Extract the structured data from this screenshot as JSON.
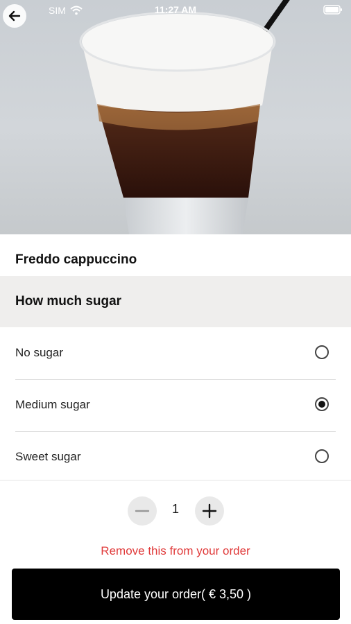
{
  "status_bar": {
    "carrier": "SIM",
    "time": "11:27 AM"
  },
  "product": {
    "name": "Freddo cappuccino"
  },
  "sugar_section": {
    "title": "How much sugar",
    "options": [
      {
        "label": "No sugar",
        "selected": false
      },
      {
        "label": "Medium sugar",
        "selected": true
      },
      {
        "label": "Sweet sugar",
        "selected": false
      }
    ]
  },
  "quantity": {
    "value": "1"
  },
  "actions": {
    "remove_label": "Remove this from your order",
    "update_label": "Update your order( € 3,50 )"
  },
  "colors": {
    "accent_red": "#e03a3a",
    "cta_bg": "#000000",
    "section_bg": "#efeeed"
  },
  "icons": [
    "back-arrow-icon",
    "wifi-icon",
    "battery-icon",
    "minus-icon",
    "plus-icon"
  ]
}
